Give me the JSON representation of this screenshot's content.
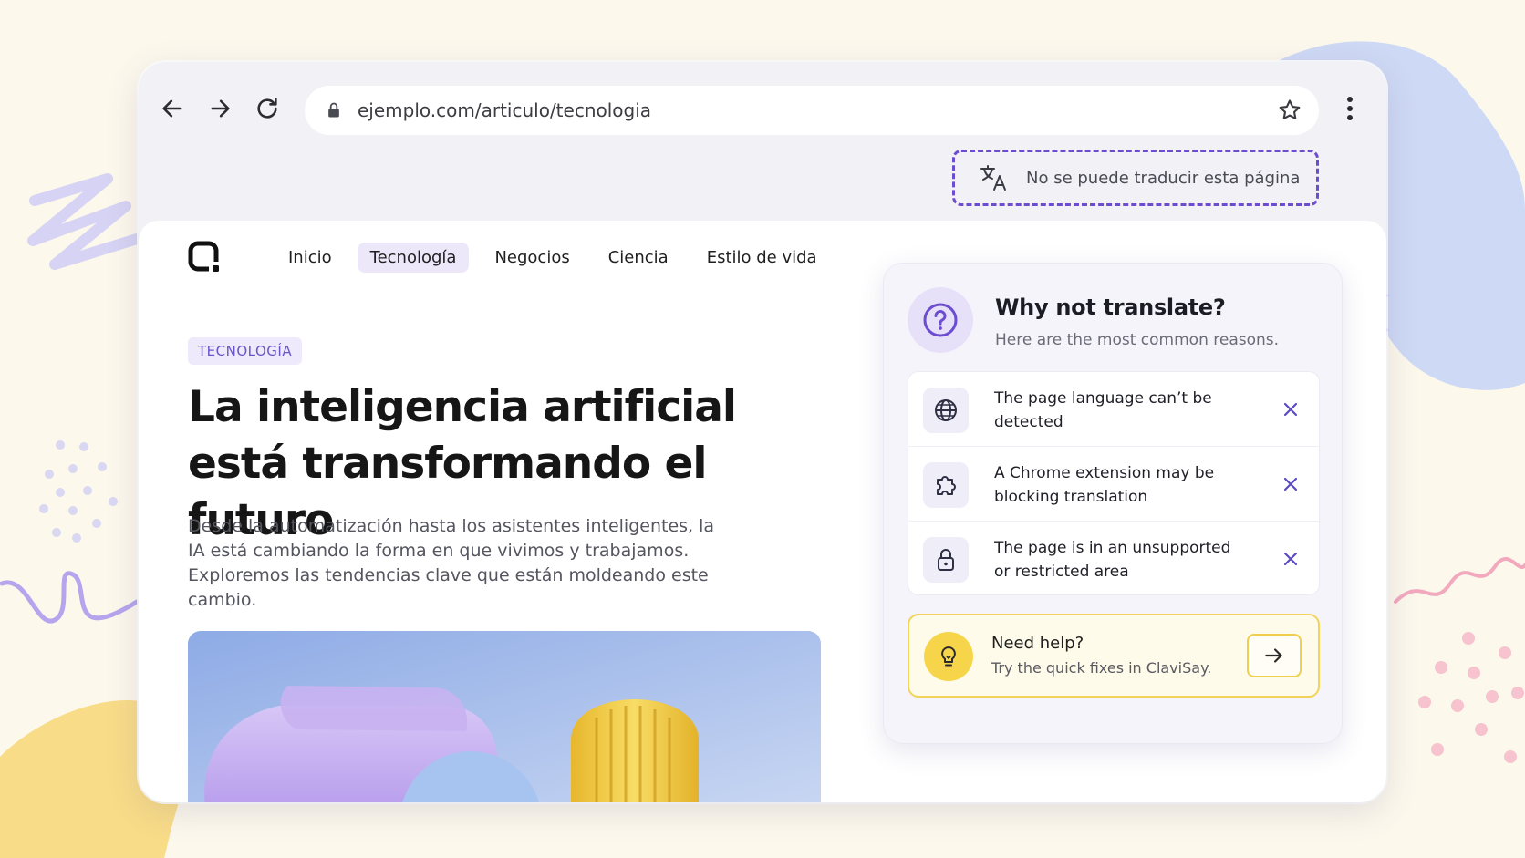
{
  "browser": {
    "url": "ejemplo.com/articulo/tecnologia",
    "translate_status": "No se puede traducir esta página"
  },
  "site": {
    "nav": [
      {
        "label": "Inicio",
        "active": false
      },
      {
        "label": "Tecnología",
        "active": true
      },
      {
        "label": "Negocios",
        "active": false
      },
      {
        "label": "Ciencia",
        "active": false
      },
      {
        "label": "Estilo de vida",
        "active": false
      }
    ]
  },
  "article": {
    "category": "TECNOLOGÍA",
    "headline_line1": "La inteligencia artificial",
    "headline_line2": "está transformando el futuro",
    "lede": "Desde la automatización hasta los asistentes inteligentes, la IA está cambiando la forma en que vivimos y trabajamos. Exploremos las tendencias clave que están moldeando este cambio."
  },
  "panel": {
    "title": "Why not translate?",
    "subtitle": "Here are the most common reasons.",
    "reasons": [
      {
        "icon": "globe-icon",
        "text": "The page language can’t be detected"
      },
      {
        "icon": "puzzle-icon",
        "text": "A Chrome extension may be blocking translation"
      },
      {
        "icon": "lock-icon",
        "text": "The page is in an unsupported or restricted area"
      }
    ],
    "help": {
      "title": "Need help?",
      "subtitle": "Try the quick fixes in ClaviSay."
    }
  },
  "colors": {
    "accent_purple": "#6c4ccf",
    "help_yellow": "#f7d54a",
    "background": "#fcf8ec"
  }
}
